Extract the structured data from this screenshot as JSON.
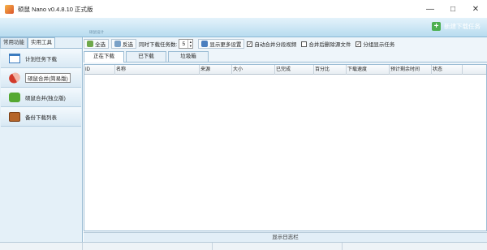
{
  "window": {
    "title": "硕鼠 Nano v0.4.8.10 正式版",
    "controls": [
      "minimize-icon",
      "maximize-icon",
      "close-icon"
    ]
  },
  "banner": {
    "small_text": "硕鼠设计",
    "new_task_label": "新建下载任务",
    "colors": {
      "banner_top": "#e4f3fb",
      "banner_bottom": "#b8dcef",
      "plus": "#4caf50"
    }
  },
  "sidebar": {
    "tabs": [
      {
        "label": "常用功能",
        "active": false
      },
      {
        "label": "实用工具",
        "active": true
      }
    ],
    "items": [
      {
        "label": "计划任务下载",
        "icon": "calendar-icon"
      },
      {
        "label": "硕鼠合并(简易版)",
        "icon": "pill-icon",
        "selected": true
      },
      {
        "label": "硕鼠合并(独立版)",
        "icon": "puzzle-icon"
      },
      {
        "label": "备份下载列表",
        "icon": "wallet-icon"
      }
    ]
  },
  "toolbar": {
    "select_all": "全选",
    "invert": "反选",
    "concurrent_label": "同时下载任务数:",
    "concurrent_value": "5",
    "more_settings": "显示更多设置",
    "options": [
      {
        "label": "自动合并分段视频",
        "checked": true
      },
      {
        "label": "合并后删除源文件",
        "checked": false
      },
      {
        "label": "分组显示任务",
        "checked": true
      }
    ]
  },
  "tabs": [
    {
      "label": "正在下载",
      "active": true
    },
    {
      "label": "已下载",
      "active": false
    },
    {
      "label": "垃圾箱",
      "active": false
    }
  ],
  "table": {
    "columns": [
      "ID",
      "名称",
      "来源",
      "大小",
      "已完成",
      "百分比",
      "下载速度",
      "预计剩余时间",
      "状态"
    ],
    "rows": []
  },
  "log_bar": {
    "label": "显示日志栏"
  }
}
